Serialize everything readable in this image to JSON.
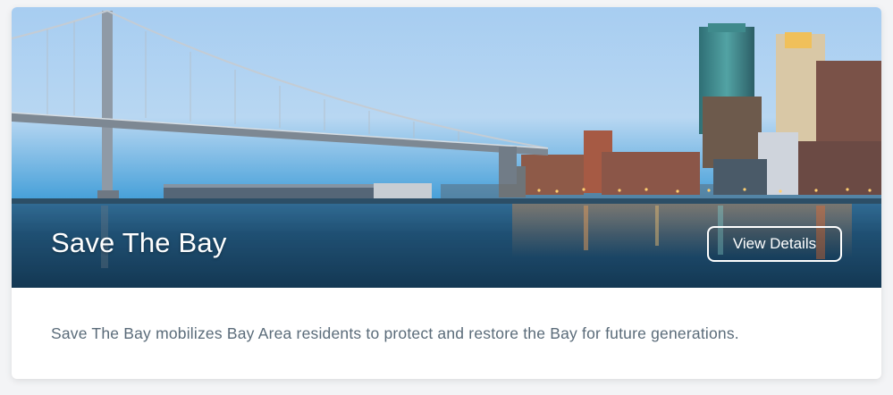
{
  "card": {
    "title": "Save The Bay",
    "button_label": "View Details",
    "description": "Save The Bay mobilizes Bay Area residents to protect and restore the Bay for future generations."
  },
  "hero_image": {
    "subject": "bay-bridge-and-city-skyline-at-dusk"
  },
  "colors": {
    "description_text": "#5a6b79",
    "sky_top": "#a9cdf0",
    "water": "#1f4f72"
  }
}
